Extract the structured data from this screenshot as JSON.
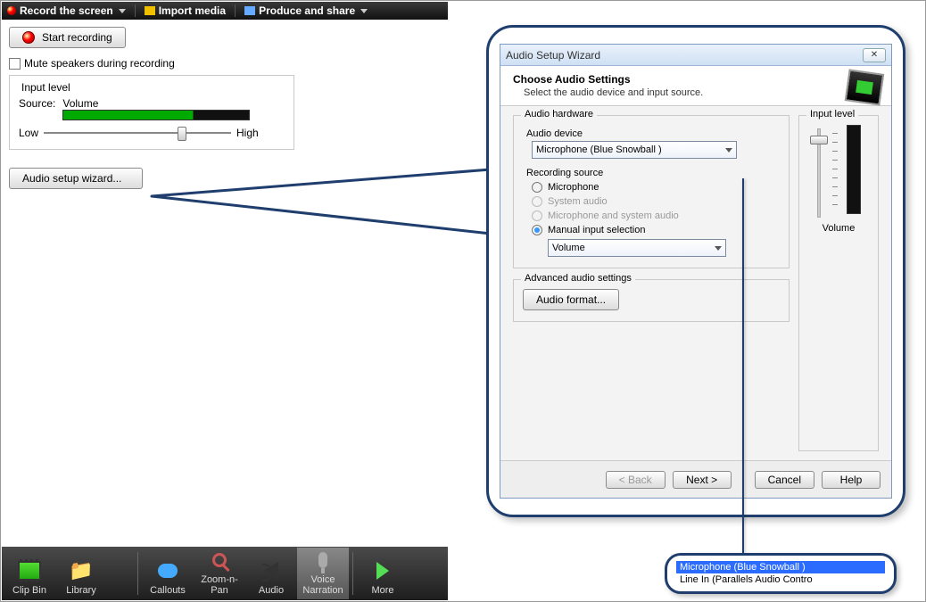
{
  "menu": {
    "record": "Record the screen",
    "import": "Import media",
    "produce": "Produce and share"
  },
  "panel": {
    "start_btn": "Start recording",
    "mute_chk": "Mute speakers during recording",
    "input_legend": "Input level",
    "source_lbl": "Source:",
    "source_val": "Volume",
    "low": "Low",
    "high": "High",
    "wizard_btn": "Audio setup wizard..."
  },
  "toolbar": {
    "clipbin": "Clip Bin",
    "library": "Library",
    "callouts": "Callouts",
    "zoom": "Zoom-n-Pan",
    "audio": "Audio",
    "voice": "Voice Narration",
    "more": "More"
  },
  "dialog": {
    "title": "Audio Setup Wizard",
    "heading": "Choose Audio Settings",
    "sub": "Select the audio device and input source.",
    "hw_legend": "Audio hardware",
    "device_lbl": "Audio device",
    "device_val": "Microphone (Blue Snowball )",
    "recsrc_lbl": "Recording source",
    "opt_mic": "Microphone",
    "opt_sys": "System audio",
    "opt_both": "Microphone and system audio",
    "opt_manual": "Manual input selection",
    "manual_val": "Volume",
    "adv_legend": "Advanced audio settings",
    "fmt_btn": "Audio format...",
    "il_legend": "Input level",
    "il_vol": "Volume",
    "back": "< Back",
    "next": "Next >",
    "cancel": "Cancel",
    "help": "Help"
  },
  "dropdown": {
    "opt1": "Microphone (Blue Snowball )",
    "opt2": "Line In (Parallels Audio Contro"
  }
}
